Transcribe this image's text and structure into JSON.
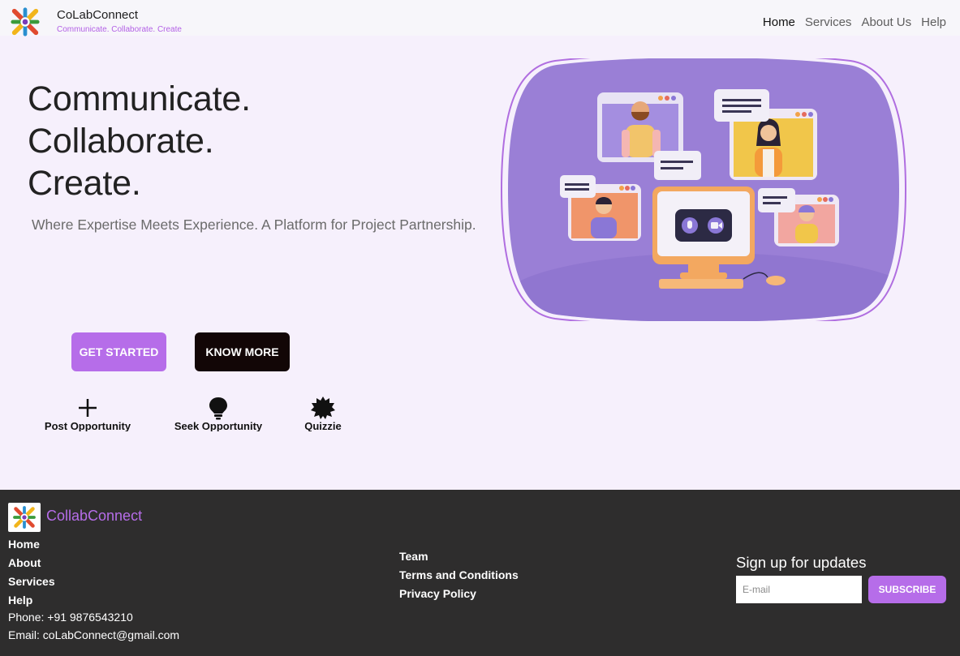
{
  "header": {
    "brand_name": "CoLabConnect",
    "tagline": "Communicate. Collaborate. Create",
    "nav": [
      {
        "label": "Home",
        "active": true
      },
      {
        "label": "Services",
        "active": false
      },
      {
        "label": "About Us",
        "active": false
      },
      {
        "label": "Help",
        "active": false
      }
    ]
  },
  "hero": {
    "headline": [
      "Communicate.",
      "Collaborate.",
      "Create."
    ],
    "subline": "Where Expertise Meets Experience. A Platform for Project Partnership.",
    "buttons": {
      "get_started": "GET STARTED",
      "know_more": "KNOW MORE"
    },
    "features": [
      {
        "icon": "plus-icon",
        "label": "Post Opportunity"
      },
      {
        "icon": "lightbulb-icon",
        "label": "Seek Opportunity"
      },
      {
        "icon": "badge-icon",
        "label": "Quizzie"
      }
    ]
  },
  "footer": {
    "brand_name": "CollabConnect",
    "links_col1": [
      "Home",
      "About",
      "Services",
      "Help"
    ],
    "phone": "Phone: +91 9876543210",
    "email": "Email: coLabConnect@gmail.com",
    "links_col2": [
      "Team",
      "Terms and Conditions",
      "Privacy Policy"
    ],
    "signup": {
      "title": "Sign up for updates",
      "placeholder": "E-mail",
      "button": "SUBSCRIBE"
    }
  },
  "colors": {
    "accent": "#b66de9",
    "dark_button": "#120606",
    "page_bg": "#f6f0fc",
    "footer_bg": "#2e2d2d",
    "illustration_bg": "#9a7fd6"
  }
}
